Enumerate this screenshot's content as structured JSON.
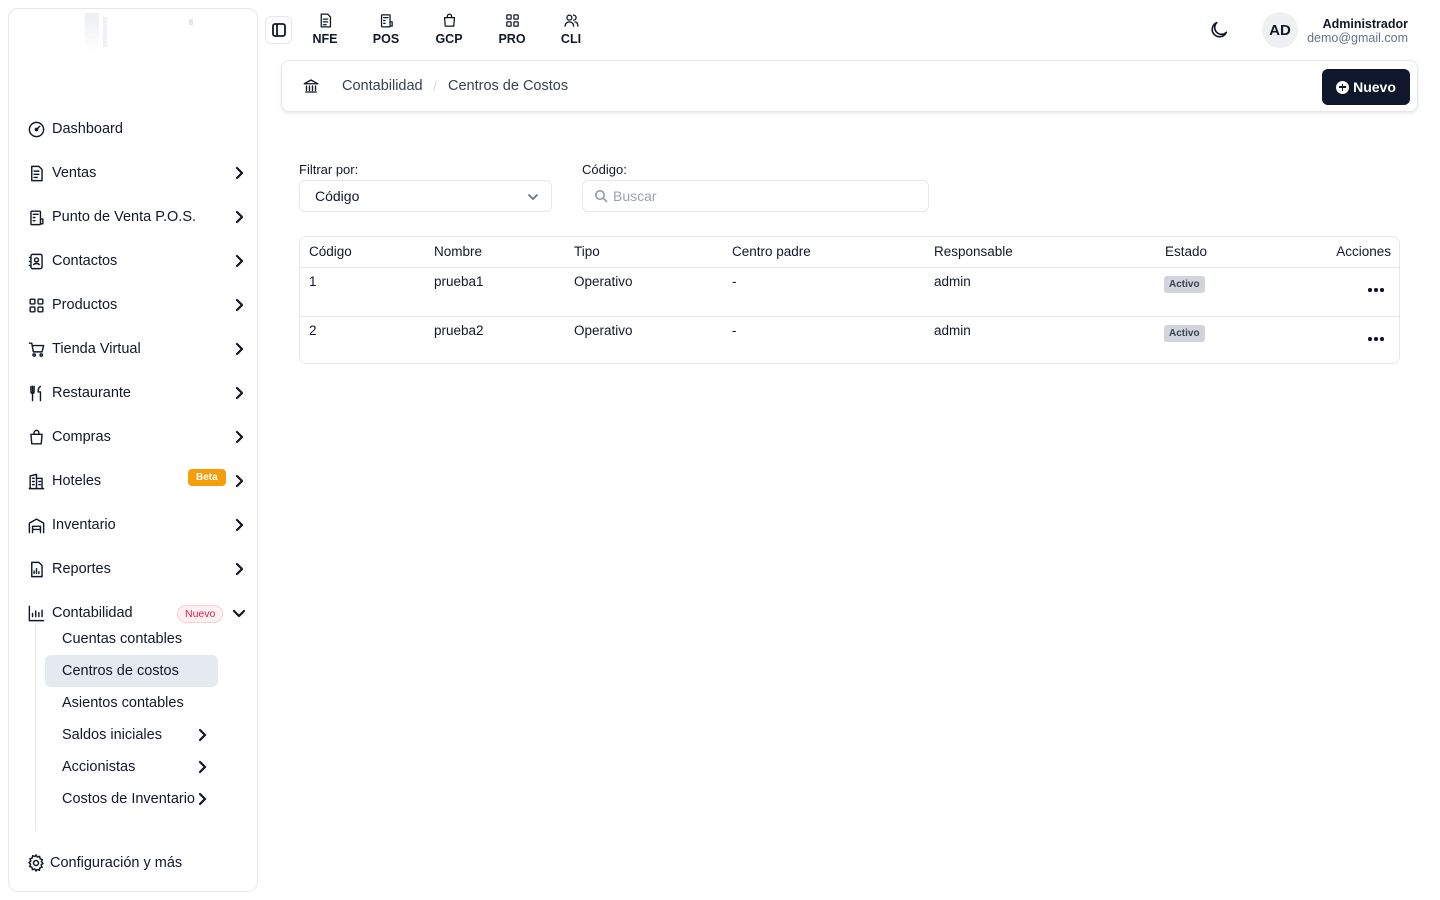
{
  "topbar": {
    "shortcuts": [
      {
        "label": "NFE",
        "icon": "document-icon"
      },
      {
        "label": "POS",
        "icon": "register-icon"
      },
      {
        "label": "GCP",
        "icon": "shopping-bag-icon"
      },
      {
        "label": "PRO",
        "icon": "grid-icon"
      },
      {
        "label": "CLI",
        "icon": "users-icon"
      }
    ],
    "user": {
      "initials": "AD",
      "name": "Administrador",
      "email": "demo@gmail.com"
    }
  },
  "sidebar": {
    "items": [
      {
        "label": "Dashboard",
        "icon": "gauge-icon",
        "has_chevron": false
      },
      {
        "label": "Ventas",
        "icon": "receipt-icon",
        "has_chevron": true
      },
      {
        "label": "Punto de Venta P.O.S.",
        "icon": "register-icon",
        "has_chevron": true
      },
      {
        "label": "Contactos",
        "icon": "contact-book-icon",
        "has_chevron": true
      },
      {
        "label": "Productos",
        "icon": "grid-icon",
        "has_chevron": true
      },
      {
        "label": "Tienda Virtual",
        "icon": "cart-icon",
        "has_chevron": true
      },
      {
        "label": "Restaurante",
        "icon": "utensils-icon",
        "has_chevron": true
      },
      {
        "label": "Compras",
        "icon": "shopping-bag-icon",
        "has_chevron": true
      },
      {
        "label": "Hoteles",
        "icon": "building-icon",
        "has_chevron": true,
        "badge": "Beta"
      },
      {
        "label": "Inventario",
        "icon": "warehouse-icon",
        "has_chevron": true
      },
      {
        "label": "Reportes",
        "icon": "report-icon",
        "has_chevron": true
      },
      {
        "label": "Contabilidad",
        "icon": "chart-icon",
        "has_chevron": true,
        "badge": "Nuevo",
        "expanded": true
      }
    ],
    "subitems": [
      {
        "label": "Cuentas contables",
        "has_chevron": false
      },
      {
        "label": "Centros de costos",
        "has_chevron": false,
        "active": true
      },
      {
        "label": "Asientos contables",
        "has_chevron": false
      },
      {
        "label": "Saldos iniciales",
        "has_chevron": true
      },
      {
        "label": "Accionistas",
        "has_chevron": true
      },
      {
        "label": "Costos de Inventario",
        "has_chevron": true
      }
    ],
    "footer_label": "Configuración y más"
  },
  "breadcrumb": {
    "root": "Contabilidad",
    "separator": "/",
    "current": "Centros de Costos"
  },
  "actions": {
    "new_label": "Nuevo"
  },
  "filters": {
    "filter_by_label": "Filtrar por:",
    "filter_by_value": "Código",
    "code_label": "Código:",
    "search_placeholder": "Buscar"
  },
  "table": {
    "columns": [
      "Código",
      "Nombre",
      "Tipo",
      "Centro padre",
      "Responsable",
      "Estado",
      "Acciones"
    ],
    "rows": [
      {
        "codigo": "1",
        "nombre": "prueba1",
        "tipo": "Operativo",
        "padre": "-",
        "responsable": "admin",
        "estado": "Activo"
      },
      {
        "codigo": "2",
        "nombre": "prueba2",
        "tipo": "Operativo",
        "padre": "-",
        "responsable": "admin",
        "estado": "Activo"
      }
    ]
  },
  "colors": {
    "primary": "#0f172a",
    "beta_badge": "#f59e0b",
    "new_badge_text": "#e11d48",
    "active_item_bg": "#e5e9f0",
    "status_bg": "#d1d5db"
  }
}
